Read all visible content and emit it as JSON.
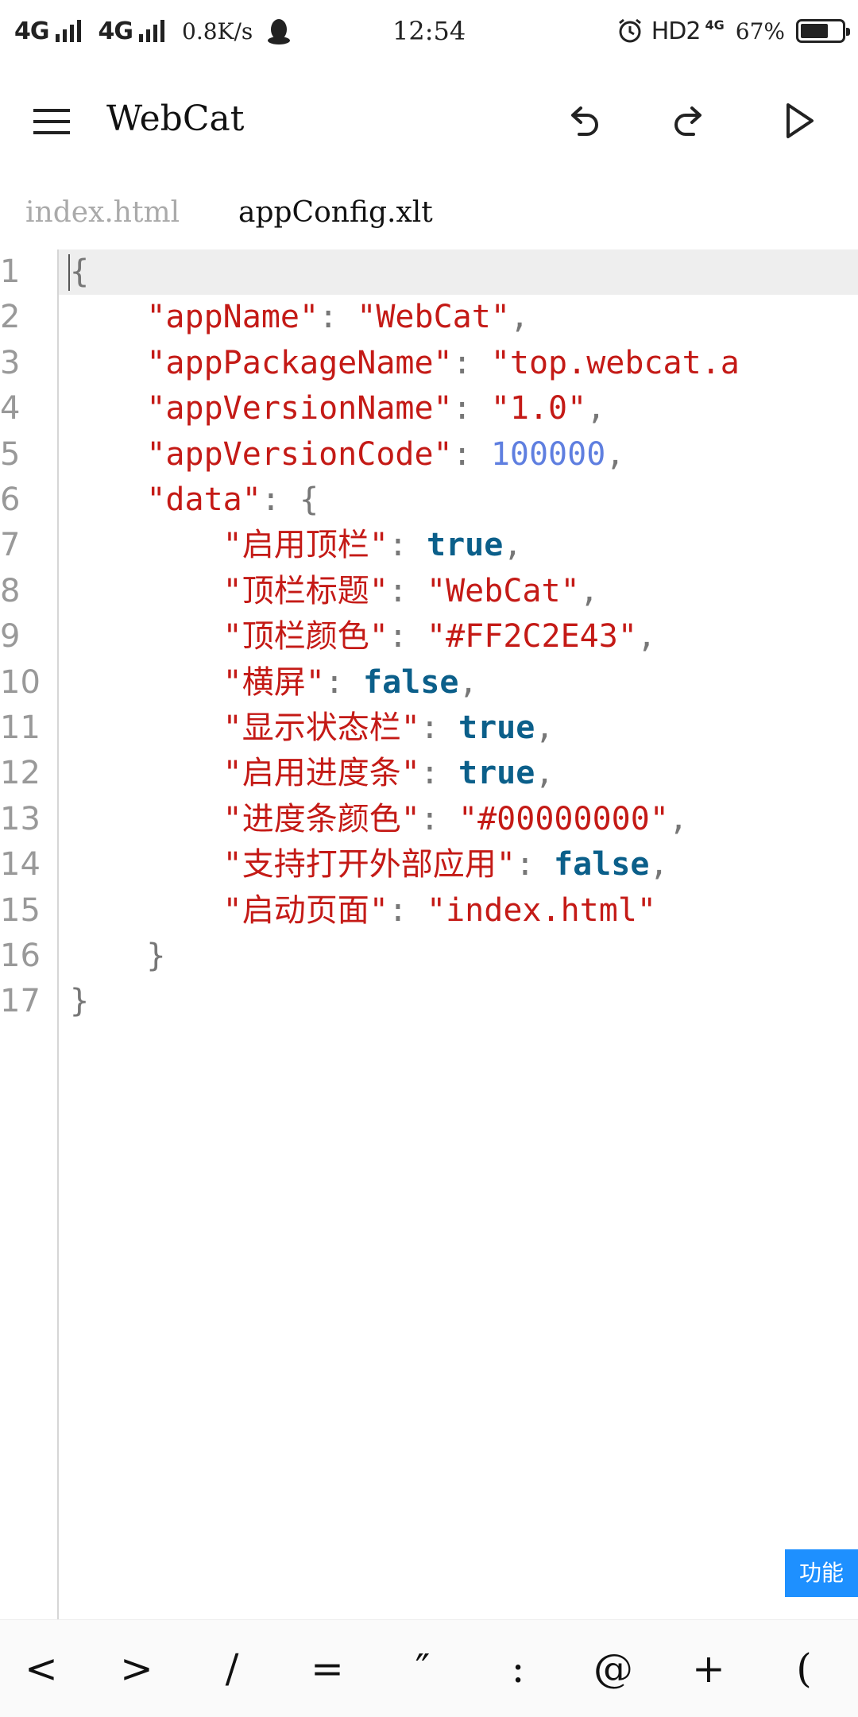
{
  "status_bar": {
    "net1": "4G",
    "net2": "4G",
    "speed": "0.8K/s",
    "time": "12:54",
    "hd": "HD2",
    "net_small": "4G",
    "battery_pct": "67%",
    "battery_level": 0.67
  },
  "toolbar": {
    "title": "WebCat"
  },
  "tabs": [
    {
      "label": "index.html",
      "active": false
    },
    {
      "label": "appConfig.xlt",
      "active": true
    }
  ],
  "editor": {
    "line_numbers": [
      "1",
      "2",
      "3",
      "4",
      "5",
      "6",
      "7",
      "8",
      "9",
      "10",
      "11",
      "12",
      "13",
      "14",
      "15",
      "16",
      "17"
    ],
    "lines": [
      [
        [
          "p",
          "{"
        ]
      ],
      [
        [
          "p",
          "    "
        ],
        [
          "s",
          "\"appName\""
        ],
        [
          "p",
          ": "
        ],
        [
          "s",
          "\"WebCat\""
        ],
        [
          "p",
          ","
        ]
      ],
      [
        [
          "p",
          "    "
        ],
        [
          "s",
          "\"appPackageName\""
        ],
        [
          "p",
          ": "
        ],
        [
          "s",
          "\"top.webcat.a"
        ]
      ],
      [
        [
          "p",
          "    "
        ],
        [
          "s",
          "\"appVersionName\""
        ],
        [
          "p",
          ": "
        ],
        [
          "s",
          "\"1.0\""
        ],
        [
          "p",
          ","
        ]
      ],
      [
        [
          "p",
          "    "
        ],
        [
          "s",
          "\"appVersionCode\""
        ],
        [
          "p",
          ": "
        ],
        [
          "n",
          "100000"
        ],
        [
          "p",
          ","
        ]
      ],
      [
        [
          "p",
          "    "
        ],
        [
          "s",
          "\"data\""
        ],
        [
          "p",
          ": {"
        ]
      ],
      [
        [
          "p",
          "        "
        ],
        [
          "s",
          "\"启用顶栏\""
        ],
        [
          "p",
          ": "
        ],
        [
          "k",
          "true"
        ],
        [
          "p",
          ","
        ]
      ],
      [
        [
          "p",
          "        "
        ],
        [
          "s",
          "\"顶栏标题\""
        ],
        [
          "p",
          ": "
        ],
        [
          "s",
          "\"WebCat\""
        ],
        [
          "p",
          ","
        ]
      ],
      [
        [
          "p",
          "        "
        ],
        [
          "s",
          "\"顶栏颜色\""
        ],
        [
          "p",
          ": "
        ],
        [
          "s",
          "\"#FF2C2E43\""
        ],
        [
          "p",
          ","
        ]
      ],
      [
        [
          "p",
          "        "
        ],
        [
          "s",
          "\"横屏\""
        ],
        [
          "p",
          ": "
        ],
        [
          "k",
          "false"
        ],
        [
          "p",
          ","
        ]
      ],
      [
        [
          "p",
          "        "
        ],
        [
          "s",
          "\"显示状态栏\""
        ],
        [
          "p",
          ": "
        ],
        [
          "k",
          "true"
        ],
        [
          "p",
          ","
        ]
      ],
      [
        [
          "p",
          "        "
        ],
        [
          "s",
          "\"启用进度条\""
        ],
        [
          "p",
          ": "
        ],
        [
          "k",
          "true"
        ],
        [
          "p",
          ","
        ]
      ],
      [
        [
          "p",
          "        "
        ],
        [
          "s",
          "\"进度条颜色\""
        ],
        [
          "p",
          ": "
        ],
        [
          "s",
          "\"#00000000\""
        ],
        [
          "p",
          ","
        ]
      ],
      [
        [
          "p",
          "        "
        ],
        [
          "s",
          "\"支持打开外部应用\""
        ],
        [
          "p",
          ": "
        ],
        [
          "k",
          "false"
        ],
        [
          "p",
          ","
        ]
      ],
      [
        [
          "p",
          "        "
        ],
        [
          "s",
          "\"启动页面\""
        ],
        [
          "p",
          ": "
        ],
        [
          "s",
          "\"index.html\""
        ]
      ],
      [
        [
          "p",
          "    }"
        ]
      ],
      [
        [
          "p",
          "}"
        ]
      ]
    ]
  },
  "func_button": "功能",
  "symbols": [
    "<",
    ">",
    "/",
    "=",
    "″",
    ":",
    "@",
    "+",
    "("
  ],
  "colors": {
    "string": "#c41a16",
    "number": "#5f7fe0",
    "keyword": "#0b5f8a",
    "punctuation": "#777777",
    "accent": "#1e90ff"
  }
}
